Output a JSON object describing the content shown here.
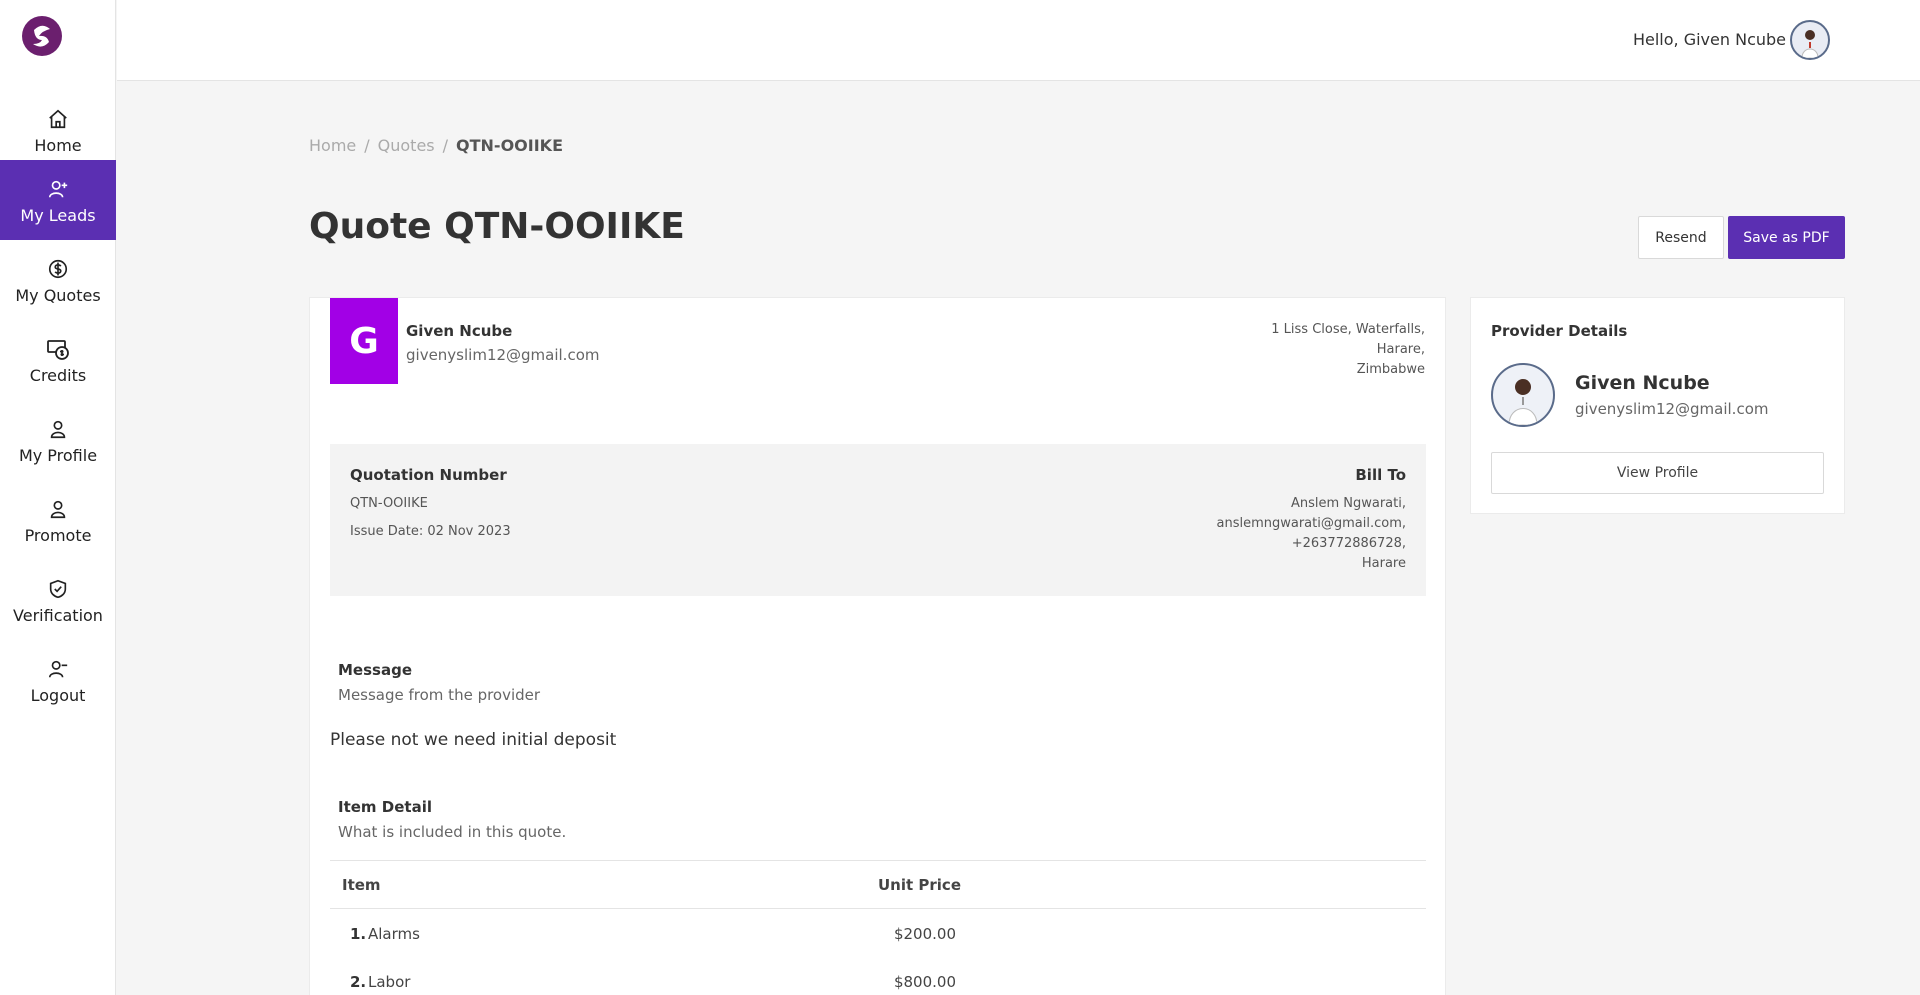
{
  "sidebar": {
    "items": [
      {
        "label": "Home",
        "icon": "home-icon"
      },
      {
        "label": "My Leads",
        "icon": "add-user-icon",
        "active": true
      },
      {
        "label": "My Quotes",
        "icon": "dollar-circle-icon"
      },
      {
        "label": "Credits",
        "icon": "credits-icon"
      },
      {
        "label": "My Profile",
        "icon": "user-icon"
      },
      {
        "label": "Promote",
        "icon": "user-icon"
      },
      {
        "label": "Verification",
        "icon": "shield-check-icon"
      },
      {
        "label": "Logout",
        "icon": "user-minus-icon"
      }
    ]
  },
  "topbar": {
    "greeting": "Hello, Given Ncube"
  },
  "breadcrumb": {
    "home": "Home",
    "sep1": "/",
    "quotes": "Quotes",
    "sep2": "/",
    "current": "QTN-OOIIKE"
  },
  "page": {
    "title": "Quote QTN-OOIIKE"
  },
  "actions": {
    "resend": "Resend",
    "save_pdf": "Save as PDF"
  },
  "quote": {
    "avatar_letter": "G",
    "provider_name": "Given Ncube",
    "provider_email": "givenyslim12@gmail.com",
    "address": [
      "1 Liss Close, Waterfalls,",
      "Harare,",
      "Zimbabwe"
    ],
    "quotation_number_label": "Quotation Number",
    "quotation_number": "QTN-OOIIKE",
    "issue_date": "Issue Date: 02 Nov 2023",
    "bill_to_label": "Bill To",
    "bill_to": [
      "Anslem Ngwarati,",
      "anslemngwarati@gmail.com,",
      "+263772886728,",
      "Harare"
    ],
    "message_label": "Message",
    "message_sub": "Message from the provider",
    "message_body": "Please not we need initial deposit",
    "item_label": "Item Detail",
    "item_sub": "What is included in this quote.",
    "columns": {
      "item": "Item",
      "unit_price": "Unit Price"
    },
    "items": [
      {
        "num": "1.",
        "name": "Alarms",
        "price": "$200.00"
      },
      {
        "num": "2.",
        "name": "Labor",
        "price": "$800.00"
      }
    ]
  },
  "provider_card": {
    "title": "Provider Details",
    "name": "Given Ncube",
    "email": "givenyslim12@gmail.com",
    "view_profile": "View Profile"
  },
  "colors": {
    "accent": "#5b2fb2",
    "avatar_bg": "#a200e6"
  }
}
